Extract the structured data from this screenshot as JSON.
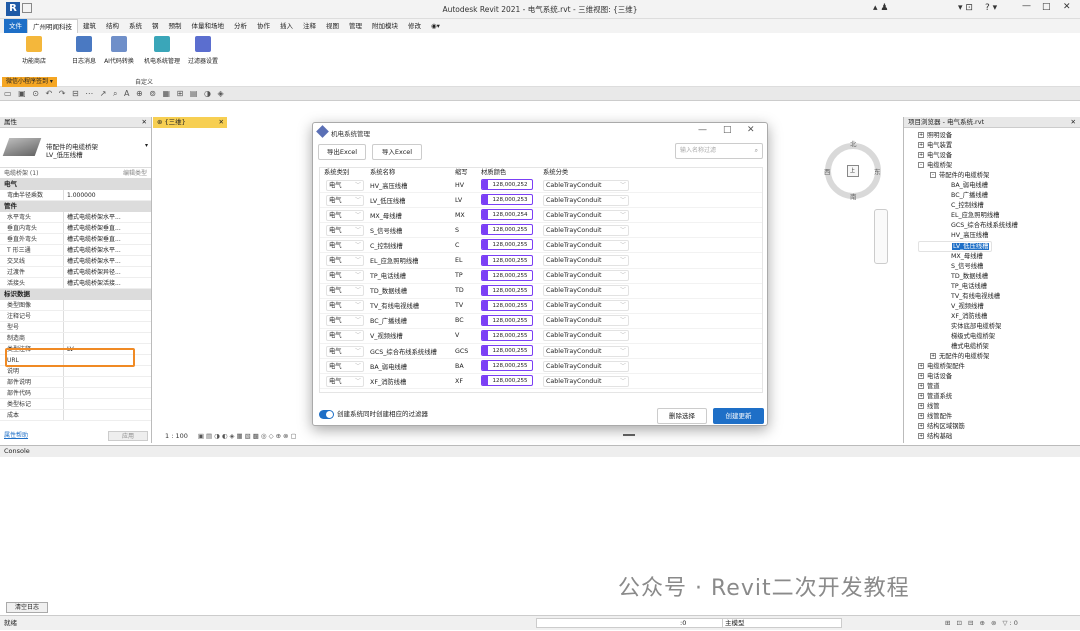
{
  "window": {
    "title": "Autodesk Revit 2021 - 电气系统.rvt - 三维视图: {三维}",
    "logo": "R"
  },
  "menu": [
    "文件",
    "广州明闻科技",
    "建筑",
    "结构",
    "系统",
    "钢",
    "预制",
    "体量和场地",
    "分析",
    "协作",
    "插入",
    "注释",
    "视图",
    "管理",
    "附加模块",
    "修改"
  ],
  "ribbon": {
    "buttons": [
      "功能商店",
      "日志消息",
      "AI代码转换",
      "机电系统管理",
      "过滤器设置"
    ],
    "group_label": "自定义",
    "wechat_label": "微信小程序签到 ▾"
  },
  "properties": {
    "header": "属性",
    "type_line1": "带配件的电缆桥架",
    "type_line2": "LV_低压线槽",
    "filter_label": "电缆桥架 (1)",
    "edit_type": "编辑类型",
    "sections": [
      {
        "name": "电气",
        "rows": [
          [
            "弯曲半径乘数",
            "1.000000"
          ]
        ]
      },
      {
        "name": "管件",
        "rows": [
          [
            "水平弯头",
            "槽式电缆桥架水平..."
          ],
          [
            "垂直内弯头",
            "槽式电缆桥架垂直..."
          ],
          [
            "垂直外弯头",
            "槽式电缆桥架垂直..."
          ],
          [
            "T 形三通",
            "槽式电缆桥架水平..."
          ],
          [
            "交叉线",
            "槽式电缆桥架水平..."
          ],
          [
            "过渡件",
            "槽式电缆桥架异径..."
          ],
          [
            "活接头",
            "槽式电缆桥架活接..."
          ]
        ]
      },
      {
        "name": "标识数据",
        "rows": [
          [
            "类型图像",
            ""
          ],
          [
            "注释记号",
            ""
          ],
          [
            "型号",
            ""
          ],
          [
            "制造商",
            ""
          ],
          [
            "类型注释",
            "LV"
          ],
          [
            "URL",
            ""
          ],
          [
            "说明",
            ""
          ],
          [
            "部件说明",
            ""
          ],
          [
            "部件代码",
            ""
          ],
          [
            "类型标记",
            ""
          ],
          [
            "成本",
            ""
          ]
        ]
      }
    ],
    "help_link": "属性帮助",
    "apply": "应用"
  },
  "view": {
    "tab": "{三维}",
    "scale": "1 : 100",
    "compass": {
      "n": "北",
      "e": "东",
      "s": "南",
      "w": "西"
    },
    "cube_face": "上"
  },
  "browser": {
    "header": "项目浏览器 - 电气系统.rvt",
    "nodes": [
      {
        "d": 0,
        "pm": "+",
        "t": "照明设备"
      },
      {
        "d": 0,
        "pm": "+",
        "t": "电气装置"
      },
      {
        "d": 0,
        "pm": "+",
        "t": "电气设备"
      },
      {
        "d": 0,
        "pm": "-",
        "t": "电缆桥架"
      },
      {
        "d": 1,
        "pm": "-",
        "t": "带配件的电缆桥架"
      },
      {
        "d": 2,
        "t": "BA_弱电线槽"
      },
      {
        "d": 2,
        "t": "BC_广播线槽"
      },
      {
        "d": 2,
        "t": "C_控制线槽"
      },
      {
        "d": 2,
        "t": "EL_应急照明线槽"
      },
      {
        "d": 2,
        "t": "GCS_综合布线系统线槽"
      },
      {
        "d": 2,
        "t": "HV_高压线槽"
      },
      {
        "d": 2,
        "t": "LV_低压线槽",
        "sel": true
      },
      {
        "d": 2,
        "t": "MX_母线槽"
      },
      {
        "d": 2,
        "t": "S_信号线槽"
      },
      {
        "d": 2,
        "t": "TD_数据线槽"
      },
      {
        "d": 2,
        "t": "TP_电话线槽"
      },
      {
        "d": 2,
        "t": "TV_有线电视线槽"
      },
      {
        "d": 2,
        "t": "V_视频线槽"
      },
      {
        "d": 2,
        "t": "XF_消防线槽"
      },
      {
        "d": 2,
        "t": "实体底部电缆桥架"
      },
      {
        "d": 2,
        "t": "梯级式电缆桥架"
      },
      {
        "d": 2,
        "t": "槽式电缆桥架"
      },
      {
        "d": 1,
        "pm": "+",
        "t": "无配件的电缆桥架"
      },
      {
        "d": 0,
        "pm": "+",
        "t": "电缆桥架配件"
      },
      {
        "d": 0,
        "pm": "+",
        "t": "电话设备"
      },
      {
        "d": 0,
        "pm": "+",
        "t": "管道"
      },
      {
        "d": 0,
        "pm": "+",
        "t": "管道系统"
      },
      {
        "d": 0,
        "pm": "+",
        "t": "线管"
      },
      {
        "d": 0,
        "pm": "+",
        "t": "线管配件"
      },
      {
        "d": 0,
        "pm": "+",
        "t": "结构区域钢筋"
      },
      {
        "d": 0,
        "pm": "+",
        "t": "结构基础"
      }
    ]
  },
  "dialog": {
    "title": "机电系统管理",
    "export": "导出Excel",
    "import": "导入Excel",
    "search_placeholder": "输入名称过滤",
    "headers": [
      "系统类别",
      "系统名称",
      "缩写",
      "材质颜色",
      "系统分类"
    ],
    "rows": [
      [
        "电气",
        "HV_高压线槽",
        "HV",
        "128,000,252",
        "CableTrayConduit"
      ],
      [
        "电气",
        "LV_低压线槽",
        "LV",
        "128,000,253",
        "CableTrayConduit"
      ],
      [
        "电气",
        "MX_母线槽",
        "MX",
        "128,000,254",
        "CableTrayConduit"
      ],
      [
        "电气",
        "S_信号线槽",
        "S",
        "128,000,255",
        "CableTrayConduit"
      ],
      [
        "电气",
        "C_控制线槽",
        "C",
        "128,000,255",
        "CableTrayConduit"
      ],
      [
        "电气",
        "EL_应急照明线槽",
        "EL",
        "128,000,255",
        "CableTrayConduit"
      ],
      [
        "电气",
        "TP_电话线槽",
        "TP",
        "128,000,255",
        "CableTrayConduit"
      ],
      [
        "电气",
        "TD_数据线槽",
        "TD",
        "128,000,255",
        "CableTrayConduit"
      ],
      [
        "电气",
        "TV_有线电视线槽",
        "TV",
        "128,000,255",
        "CableTrayConduit"
      ],
      [
        "电气",
        "BC_广播线槽",
        "BC",
        "128,000,255",
        "CableTrayConduit"
      ],
      [
        "电气",
        "V_视频线槽",
        "V",
        "128,000,255",
        "CableTrayConduit"
      ],
      [
        "电气",
        "GCS_综合布线系统线槽",
        "GCS",
        "128,000,255",
        "CableTrayConduit"
      ],
      [
        "电气",
        "BA_弱电线槽",
        "BA",
        "128,000,255",
        "CableTrayConduit"
      ],
      [
        "电气",
        "XF_消防线槽",
        "XF",
        "128,000,255",
        "CableTrayConduit"
      ]
    ],
    "swatch_color": "#7b3ff5",
    "toggle_label": "创建系统同时创建相应的过滤器",
    "delete": "删除选择",
    "create": "创建更新"
  },
  "console": {
    "header": "Console",
    "clear": "清空日志"
  },
  "status": {
    "left": "就绪",
    "model": "主模型",
    "zero": ":0"
  },
  "watermark": "公众号 · Revit二次开发教程"
}
